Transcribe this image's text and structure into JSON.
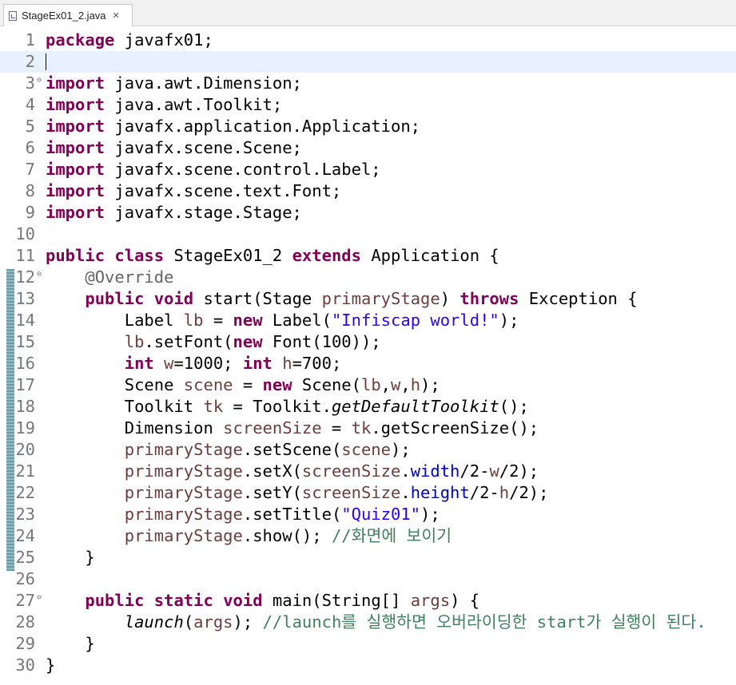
{
  "tab": {
    "title": "StageEx01_2.java",
    "close_glyph": "✕"
  },
  "lines": [
    {
      "num": "1",
      "tokens": [
        {
          "t": "package",
          "c": "kw"
        },
        {
          "t": " javafx01;"
        }
      ]
    },
    {
      "num": "2",
      "tokens": [],
      "current": true
    },
    {
      "num": "3",
      "fold": true,
      "tokens": [
        {
          "t": "import",
          "c": "kw"
        },
        {
          "t": " java.awt.Dimension;"
        }
      ]
    },
    {
      "num": "4",
      "tokens": [
        {
          "t": "import",
          "c": "kw"
        },
        {
          "t": " java.awt.Toolkit;"
        }
      ]
    },
    {
      "num": "5",
      "tokens": [
        {
          "t": "import",
          "c": "kw"
        },
        {
          "t": " javafx.application.Application;"
        }
      ]
    },
    {
      "num": "6",
      "tokens": [
        {
          "t": "import",
          "c": "kw"
        },
        {
          "t": " javafx.scene.Scene;"
        }
      ]
    },
    {
      "num": "7",
      "tokens": [
        {
          "t": "import",
          "c": "kw"
        },
        {
          "t": " javafx.scene.control.Label;"
        }
      ]
    },
    {
      "num": "8",
      "tokens": [
        {
          "t": "import",
          "c": "kw"
        },
        {
          "t": " javafx.scene.text.Font;"
        }
      ]
    },
    {
      "num": "9",
      "tokens": [
        {
          "t": "import",
          "c": "kw"
        },
        {
          "t": " javafx.stage.Stage;"
        }
      ]
    },
    {
      "num": "10",
      "tokens": []
    },
    {
      "num": "11",
      "tokens": [
        {
          "t": "public",
          "c": "kw"
        },
        {
          "t": " "
        },
        {
          "t": "class",
          "c": "kw"
        },
        {
          "t": " StageEx01_2 "
        },
        {
          "t": "extends",
          "c": "kw"
        },
        {
          "t": " Application {"
        }
      ]
    },
    {
      "num": "12",
      "fold": true,
      "tokens": [
        {
          "t": "    "
        },
        {
          "t": "@Override",
          "c": "ann"
        }
      ]
    },
    {
      "num": "13",
      "tokens": [
        {
          "t": "    "
        },
        {
          "t": "public",
          "c": "kw"
        },
        {
          "t": " "
        },
        {
          "t": "void",
          "c": "kw"
        },
        {
          "t": " start(Stage "
        },
        {
          "t": "primaryStage",
          "c": "var"
        },
        {
          "t": ") "
        },
        {
          "t": "throws",
          "c": "kw"
        },
        {
          "t": " Exception {"
        }
      ]
    },
    {
      "num": "14",
      "tokens": [
        {
          "t": "        Label "
        },
        {
          "t": "lb",
          "c": "var"
        },
        {
          "t": " = "
        },
        {
          "t": "new",
          "c": "kw"
        },
        {
          "t": " Label("
        },
        {
          "t": "\"Infiscap world!\"",
          "c": "str"
        },
        {
          "t": ");"
        }
      ]
    },
    {
      "num": "15",
      "tokens": [
        {
          "t": "        "
        },
        {
          "t": "lb",
          "c": "var"
        },
        {
          "t": ".setFont("
        },
        {
          "t": "new",
          "c": "kw"
        },
        {
          "t": " Font(100));"
        }
      ]
    },
    {
      "num": "16",
      "tokens": [
        {
          "t": "        "
        },
        {
          "t": "int",
          "c": "kw"
        },
        {
          "t": " "
        },
        {
          "t": "w",
          "c": "var"
        },
        {
          "t": "=1000; "
        },
        {
          "t": "int",
          "c": "kw"
        },
        {
          "t": " "
        },
        {
          "t": "h",
          "c": "var"
        },
        {
          "t": "=700;"
        }
      ]
    },
    {
      "num": "17",
      "tokens": [
        {
          "t": "        Scene "
        },
        {
          "t": "scene",
          "c": "var"
        },
        {
          "t": " = "
        },
        {
          "t": "new",
          "c": "kw"
        },
        {
          "t": " Scene("
        },
        {
          "t": "lb",
          "c": "var"
        },
        {
          "t": ","
        },
        {
          "t": "w",
          "c": "var"
        },
        {
          "t": ","
        },
        {
          "t": "h",
          "c": "var"
        },
        {
          "t": ");"
        }
      ]
    },
    {
      "num": "18",
      "tokens": [
        {
          "t": "        Toolkit "
        },
        {
          "t": "tk",
          "c": "var"
        },
        {
          "t": " = Toolkit."
        },
        {
          "t": "getDefaultToolkit",
          "c": "it"
        },
        {
          "t": "();"
        }
      ]
    },
    {
      "num": "19",
      "tokens": [
        {
          "t": "        Dimension "
        },
        {
          "t": "screenSize",
          "c": "var"
        },
        {
          "t": " = "
        },
        {
          "t": "tk",
          "c": "var"
        },
        {
          "t": ".getScreenSize();"
        }
      ]
    },
    {
      "num": "20",
      "tokens": [
        {
          "t": "        "
        },
        {
          "t": "primaryStage",
          "c": "var"
        },
        {
          "t": ".setScene("
        },
        {
          "t": "scene",
          "c": "var"
        },
        {
          "t": ");"
        }
      ]
    },
    {
      "num": "21",
      "tokens": [
        {
          "t": "        "
        },
        {
          "t": "primaryStage",
          "c": "var"
        },
        {
          "t": ".setX("
        },
        {
          "t": "screenSize",
          "c": "var"
        },
        {
          "t": "."
        },
        {
          "t": "width",
          "c": "fld"
        },
        {
          "t": "/2-"
        },
        {
          "t": "w",
          "c": "var"
        },
        {
          "t": "/2);"
        }
      ]
    },
    {
      "num": "22",
      "tokens": [
        {
          "t": "        "
        },
        {
          "t": "primaryStage",
          "c": "var"
        },
        {
          "t": ".setY("
        },
        {
          "t": "screenSize",
          "c": "var"
        },
        {
          "t": "."
        },
        {
          "t": "height",
          "c": "fld"
        },
        {
          "t": "/2-"
        },
        {
          "t": "h",
          "c": "var"
        },
        {
          "t": "/2);"
        }
      ]
    },
    {
      "num": "23",
      "tokens": [
        {
          "t": "        "
        },
        {
          "t": "primaryStage",
          "c": "var"
        },
        {
          "t": ".setTitle("
        },
        {
          "t": "\"Quiz01\"",
          "c": "str"
        },
        {
          "t": ");"
        }
      ]
    },
    {
      "num": "24",
      "tokens": [
        {
          "t": "        "
        },
        {
          "t": "primaryStage",
          "c": "var"
        },
        {
          "t": ".show(); "
        },
        {
          "t": "//화면에 보이기",
          "c": "cm"
        }
      ]
    },
    {
      "num": "25",
      "tokens": [
        {
          "t": "    }"
        }
      ]
    },
    {
      "num": "26",
      "tokens": []
    },
    {
      "num": "27",
      "fold": true,
      "tokens": [
        {
          "t": "    "
        },
        {
          "t": "public",
          "c": "kw"
        },
        {
          "t": " "
        },
        {
          "t": "static",
          "c": "kw"
        },
        {
          "t": " "
        },
        {
          "t": "void",
          "c": "kw"
        },
        {
          "t": " main(String[] "
        },
        {
          "t": "args",
          "c": "var"
        },
        {
          "t": ") {"
        }
      ]
    },
    {
      "num": "28",
      "tokens": [
        {
          "t": "        "
        },
        {
          "t": "launch",
          "c": "it"
        },
        {
          "t": "("
        },
        {
          "t": "args",
          "c": "var"
        },
        {
          "t": "); "
        },
        {
          "t": "//launch를 실행하면 오버라이딩한 start가 실행이 된다.",
          "c": "cm"
        }
      ]
    },
    {
      "num": "29",
      "tokens": [
        {
          "t": "    }"
        }
      ]
    },
    {
      "num": "30",
      "tokens": [
        {
          "t": "}"
        }
      ]
    }
  ],
  "colors": {
    "keyword": "#7f0055",
    "string": "#2a00ff",
    "annotation": "#646464",
    "local_variable": "#6a3e3e",
    "field": "#0000c0",
    "comment": "#3f7f5f",
    "current_line": "#e8f2fe",
    "line_number": "#787878"
  },
  "icons": {
    "file": "java-file-icon",
    "fold": "fold-minus-icon",
    "close": "close-icon"
  }
}
